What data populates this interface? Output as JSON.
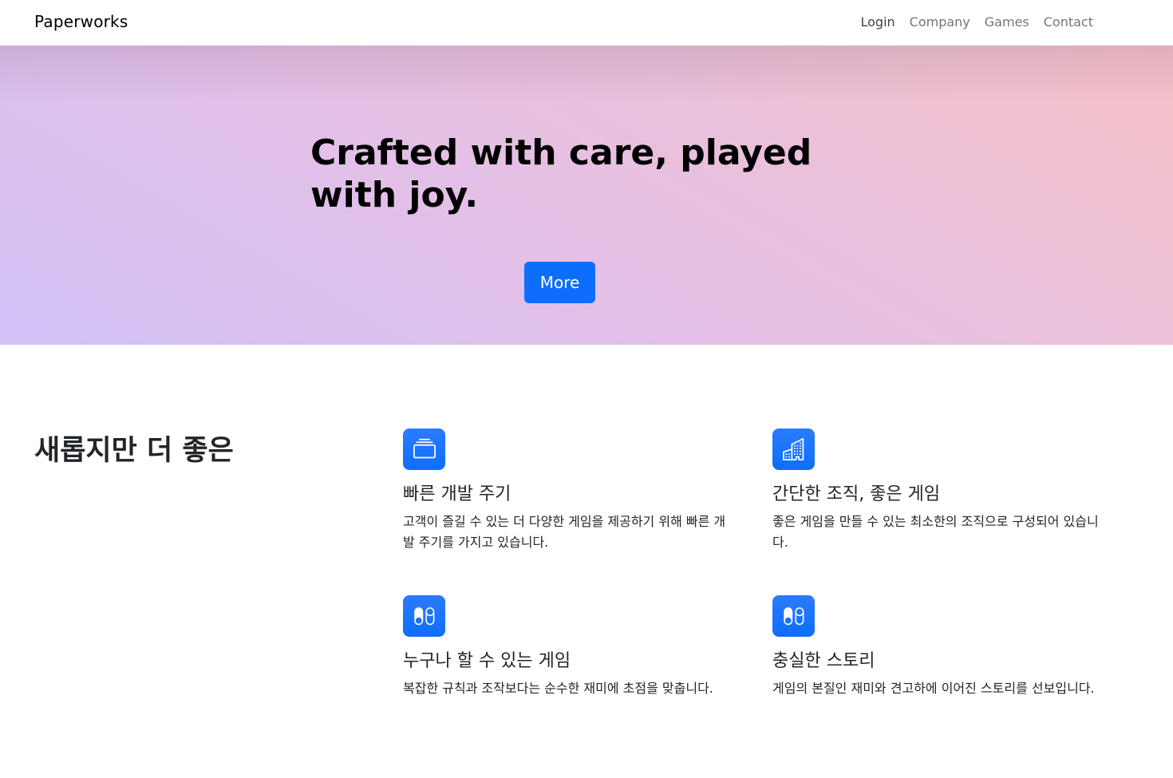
{
  "navbar": {
    "brand": "Paperworks",
    "links": [
      {
        "label": "Login"
      },
      {
        "label": "Company"
      },
      {
        "label": "Games"
      },
      {
        "label": "Contact"
      }
    ]
  },
  "hero": {
    "title": "Crafted with care, played with joy.",
    "button_label": "More",
    "colors": {
      "gradient_start": "#d1c1f7",
      "gradient_end": "#f6c1c7",
      "button": "#0d6efd"
    }
  },
  "features": {
    "heading": "새롭지만 더 좋은",
    "items": [
      {
        "icon": "collection-icon",
        "title": "빠른 개발 주기",
        "description": "고객이 즐길 수 있는 더 다양한 게임을 제공하기 위해 빠른 개발 주기를 가지고 있습니다."
      },
      {
        "icon": "building-icon",
        "title": "간단한 조직, 좋은 게임",
        "description": "좋은 게임을 만들 수 있는 최소한의 조직으로 구성되어 있습니다."
      },
      {
        "icon": "toggles-icon",
        "title": "누구나 할 수 있는 게임",
        "description": "복잡한 규칙과 조작보다는 순수한 재미에 초점을 맞춥니다."
      },
      {
        "icon": "toggles-icon",
        "title": "충실한 스토리",
        "description": "게임의 본질인 재미와 견고하에 이어진 스토리를 선보입니다."
      }
    ]
  }
}
